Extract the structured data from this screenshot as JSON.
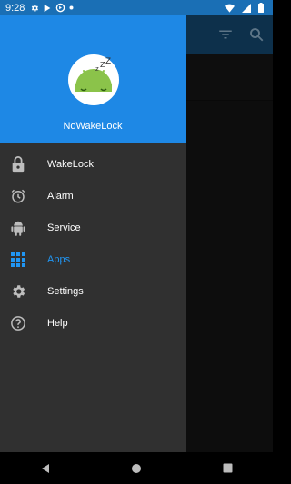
{
  "status_bar": {
    "time": "9:28",
    "left_icons": [
      "gear-icon",
      "play-store-icon",
      "sync-icon",
      "notification-dot-icon"
    ],
    "right_icons": [
      "wifi-icon",
      "signal-icon",
      "battery-icon"
    ]
  },
  "app_bar": {
    "actions": [
      "filter-icon",
      "search-icon"
    ]
  },
  "drawer": {
    "header": {
      "app_name": "NoWakeLock",
      "avatar_icon": "sleeping-android-icon"
    },
    "items": [
      {
        "label": "WakeLock",
        "icon": "lock-icon",
        "active": false
      },
      {
        "label": "Alarm",
        "icon": "alarm-icon",
        "active": false
      },
      {
        "label": "Service",
        "icon": "android-icon",
        "active": false
      },
      {
        "label": "Apps",
        "icon": "apps-grid-icon",
        "active": true
      },
      {
        "label": "Settings",
        "icon": "gear-icon",
        "active": false
      },
      {
        "label": "Help",
        "icon": "help-icon",
        "active": false
      }
    ]
  },
  "nav_bar": {
    "buttons": [
      "back-icon",
      "home-icon",
      "recents-icon"
    ]
  },
  "colors": {
    "primary": "#1e88e5",
    "status_bar": "#1a6fb5",
    "drawer_bg": "#303030",
    "active_item": "#2196f3"
  }
}
